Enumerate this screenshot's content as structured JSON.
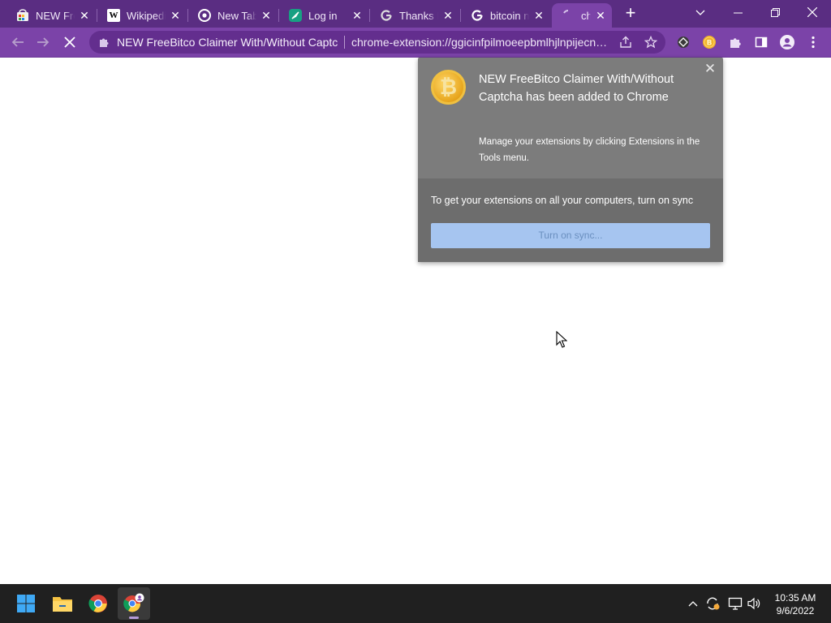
{
  "browser": {
    "tabs": [
      {
        "title": "NEW FreeBitco Claimer With/Without Captcha",
        "icon": "chrome-webstore-icon",
        "active": false
      },
      {
        "title": "Wikipedia",
        "icon": "wikipedia-icon",
        "active": false
      },
      {
        "title": "New Tab",
        "icon": "chrome-icon",
        "active": false
      },
      {
        "title": "Log in",
        "icon": "feather-icon",
        "active": false
      },
      {
        "title": "Thanks For",
        "icon": "google-icon",
        "active": false
      },
      {
        "title": "bitcoin nu",
        "icon": "google-icon",
        "active": false
      },
      {
        "title": "chr",
        "icon": "loading-icon",
        "active": true
      }
    ],
    "new_tab_label": "+",
    "omnibox": {
      "page_name": "NEW FreeBitco Claimer With/Without Captcha",
      "url": "chrome-extension://ggicinfpilmoeepbmlhjlnpijecnhfbf/"
    }
  },
  "popup": {
    "headline": "NEW FreeBitco Claimer With/Without Captcha has been added to Chrome",
    "subtext": "Manage your extensions by clicking Extensions in the Tools menu.",
    "sync_message": "To get your extensions on all your computers, turn on sync",
    "sync_button": "Turn on sync..."
  },
  "taskbar": {
    "time": "10:35 AM",
    "date": "9/6/2022"
  },
  "colors": {
    "accent": "#7b43a8",
    "tabstrip": "#5a2d82",
    "popup_bg": "#7c7c7c",
    "sync_button": "#a6c5f0"
  }
}
